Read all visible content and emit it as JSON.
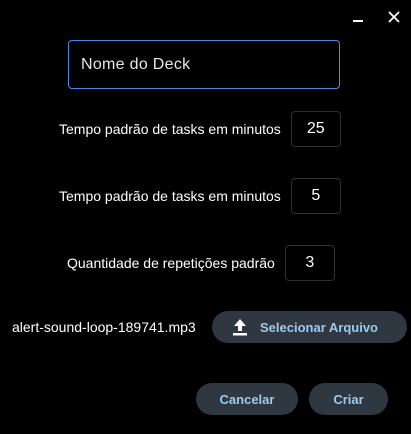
{
  "window_controls": {
    "minimize_icon": "minimize-icon",
    "close_icon": "close-icon"
  },
  "deck_name": {
    "placeholder": "Nome do Deck",
    "value": ""
  },
  "fields": [
    {
      "label": "Tempo padrão de tasks em minutos",
      "value": "25"
    },
    {
      "label": "Tempo padrão de tasks em minutos",
      "value": "5"
    },
    {
      "label": "Quantidade de repetições padrão",
      "value": "3"
    }
  ],
  "sound": {
    "file_name": "alert-sound-loop-189741.mp3",
    "select_label": "Selecionar Arquivo",
    "select_icon": "upload-icon"
  },
  "actions": {
    "cancel_label": "Cancelar",
    "create_label": "Criar"
  },
  "colors": {
    "background": "#000000",
    "accent_border": "#4a8de0",
    "button_bg": "#2f3840",
    "button_text": "#9ec9ef"
  }
}
